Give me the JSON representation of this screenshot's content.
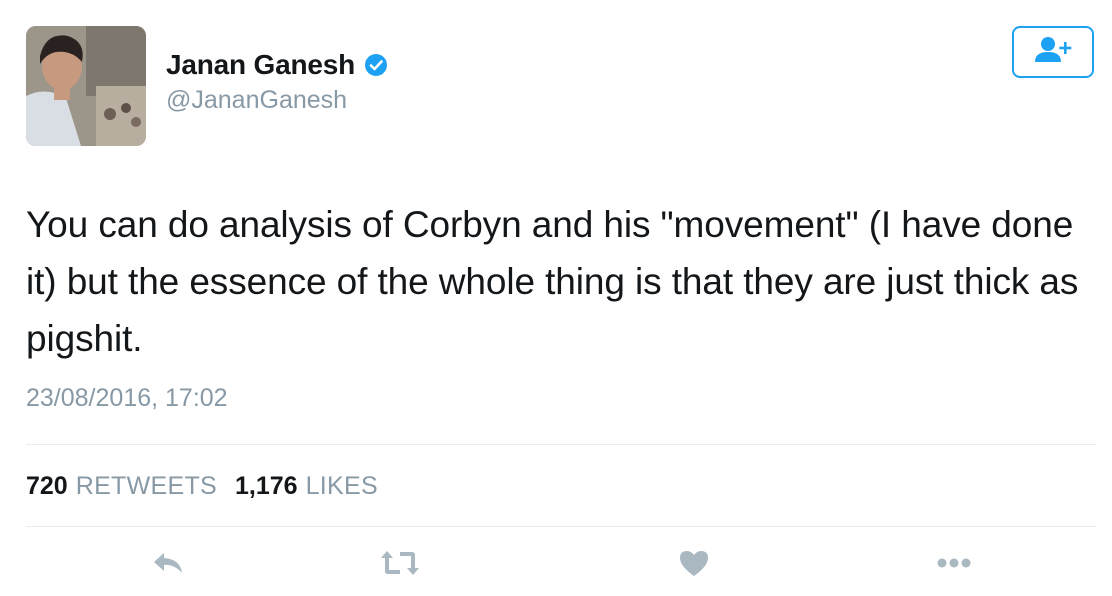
{
  "author": {
    "display_name": "Janan Ganesh",
    "handle": "@JananGanesh",
    "verified": true
  },
  "tweet": {
    "text": "You can do analysis of Corbyn and his \"movement\" (I have done it) but the essence of the whole thing is that they are just thick as pigshit.",
    "timestamp": "23/08/2016, 17:02"
  },
  "stats": {
    "retweets_count": "720",
    "retweets_label": "RETWEETS",
    "likes_count": "1,176",
    "likes_label": "LIKES"
  },
  "actions": {
    "icons": [
      "reply-icon",
      "retweet-icon",
      "heart-icon",
      "more-icon"
    ]
  },
  "colors": {
    "accent": "#1da1f2",
    "muted_text": "#8899a6",
    "icon_gray": "#aab8c2",
    "text": "#14171a"
  }
}
